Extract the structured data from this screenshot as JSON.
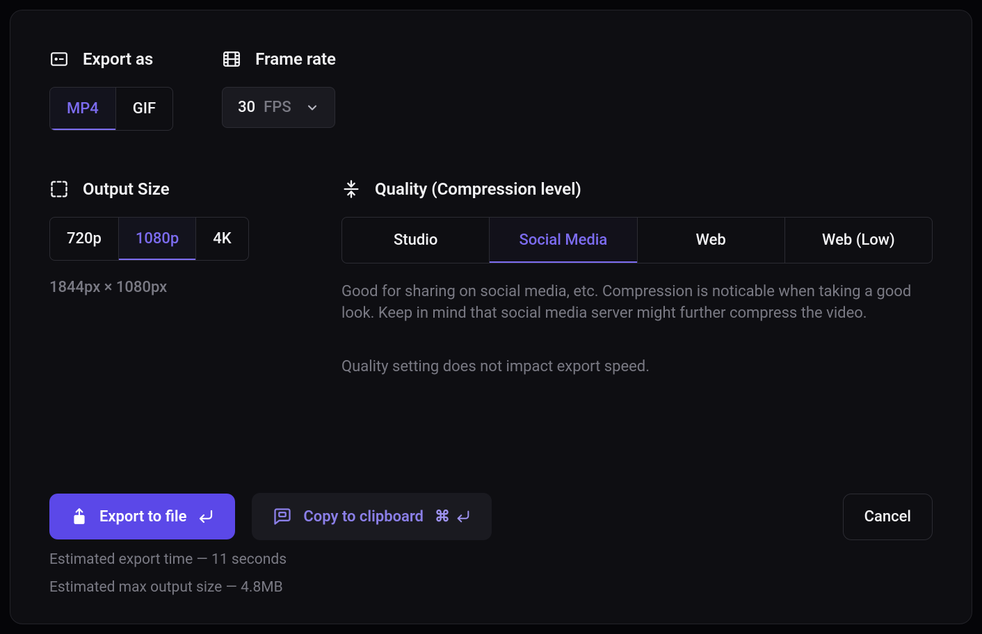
{
  "export_as": {
    "title": "Export as",
    "options": [
      "MP4",
      "GIF"
    ],
    "selected": "MP4"
  },
  "frame_rate": {
    "title": "Frame rate",
    "value": "30",
    "unit": "FPS"
  },
  "output_size": {
    "title": "Output Size",
    "options": [
      "720p",
      "1080p",
      "4K"
    ],
    "selected": "1080p",
    "dimensions": "1844px × 1080px"
  },
  "quality": {
    "title": "Quality (Compression level)",
    "options": [
      "Studio",
      "Social Media",
      "Web",
      "Web (Low)"
    ],
    "selected": "Social Media",
    "description": "Good for sharing on social media, etc. Compression is noticable when taking a good look. Keep in mind that social media server might further compress the video.",
    "note": "Quality setting does not impact export speed."
  },
  "actions": {
    "export_label": "Export to file",
    "copy_label": "Copy to clipboard",
    "copy_shortcut": "⌘",
    "cancel_label": "Cancel"
  },
  "estimates": {
    "time": "Estimated export time — 11 seconds",
    "size": "Estimated max output size — 4.8MB"
  }
}
